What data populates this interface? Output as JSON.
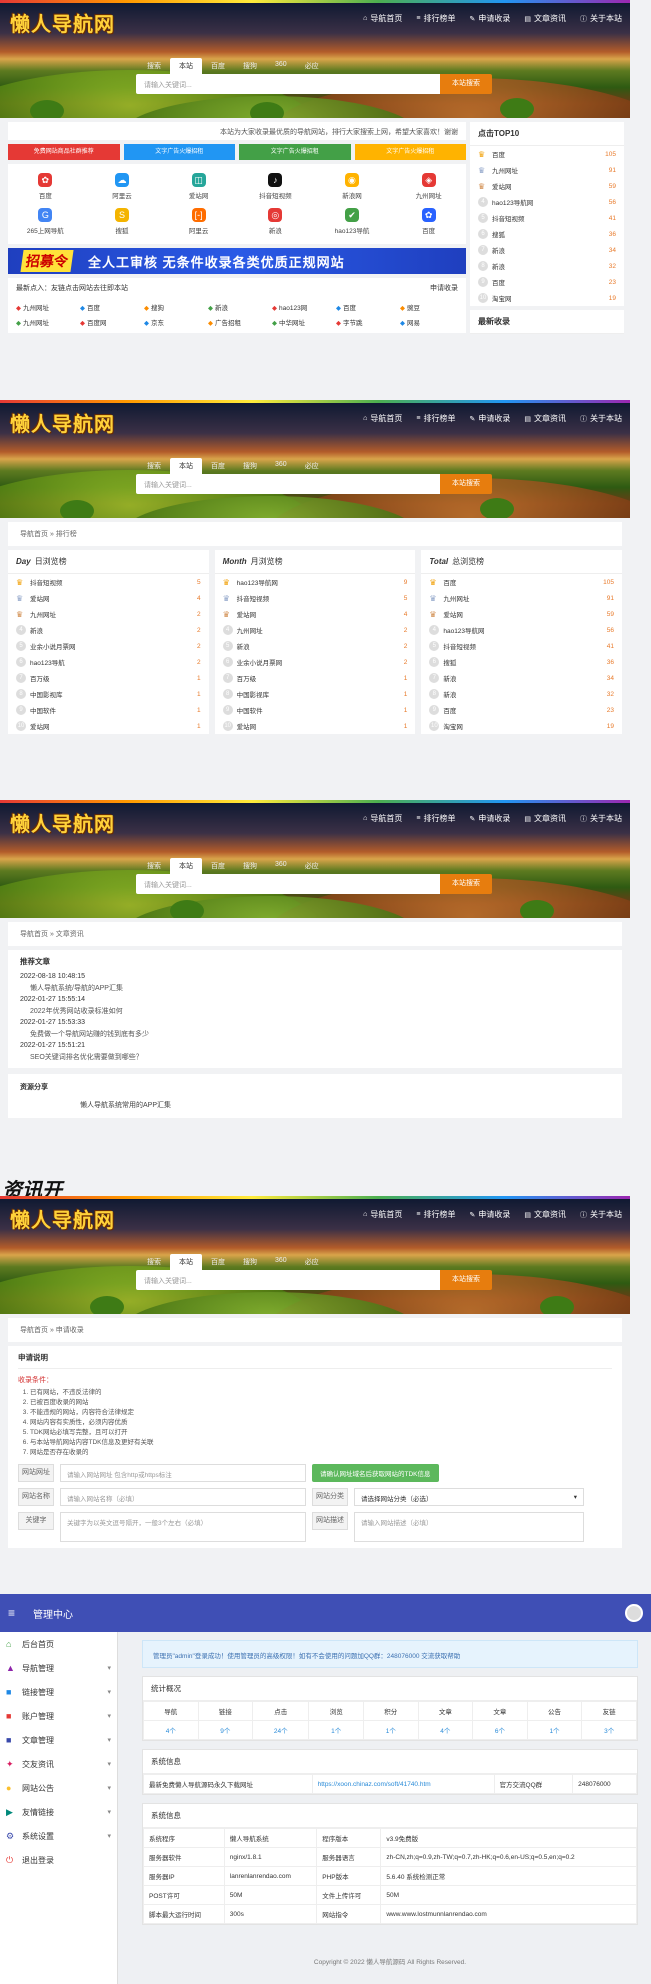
{
  "site": {
    "logo": "懒人导航网",
    "nav": [
      {
        "icon": "⌂",
        "label": "导航首页"
      },
      {
        "icon": "≡",
        "label": "排行榜单"
      },
      {
        "icon": "✎",
        "label": "申请收录"
      },
      {
        "icon": "▤",
        "label": "文章资讯"
      },
      {
        "icon": "ⓘ",
        "label": "关于本站"
      }
    ],
    "search_tabs": [
      "搜索",
      "本站",
      "百度",
      "搜狗",
      "360",
      "必应"
    ],
    "search_placeholder": "请输入关键词...",
    "search_button": "本站搜索"
  },
  "home": {
    "notice": "本站为大家收录最优质的导航网站，排行大家搜索上网，希望大家喜欢！谢谢",
    "ads": [
      {
        "label": "免费网站商品社群推荐",
        "color": "#e53935"
      },
      {
        "label": "文字广告火爆招租",
        "color": "#2196f3"
      },
      {
        "label": "文字广告火爆招租",
        "color": "#43a047"
      },
      {
        "label": "文字广告火爆招租",
        "color": "#ffb300"
      }
    ],
    "icons": [
      {
        "label": "百度",
        "glyph": "✿",
        "color": "#e53935"
      },
      {
        "label": "阿里云",
        "glyph": "☁",
        "color": "#2196f3"
      },
      {
        "label": "爱站网",
        "glyph": "◫",
        "color": "#26a69a"
      },
      {
        "label": "抖音短视频",
        "glyph": "♪",
        "color": "#111111"
      },
      {
        "label": "新浪网",
        "glyph": "◉",
        "color": "#ffb300"
      },
      {
        "label": "九州网址",
        "glyph": "◈",
        "color": "#e53935"
      },
      {
        "label": "265上网导航",
        "glyph": "G",
        "color": "#4285f4"
      },
      {
        "label": "搜狐",
        "glyph": "S",
        "color": "#f4b400"
      },
      {
        "label": "阿里云",
        "glyph": "[-]",
        "color": "#ff6d00"
      },
      {
        "label": "新浪",
        "glyph": "◎",
        "color": "#e53935"
      },
      {
        "label": "hao123导航",
        "glyph": "✔",
        "color": "#43a047"
      },
      {
        "label": "百度",
        "glyph": "✿",
        "color": "#2962ff"
      }
    ],
    "banner_tag": "招募令",
    "banner_text": "全人工审核 无条件收录各类优质正规网站",
    "include_label": "最新点入：友链点击网站去往即本站",
    "include_btn": "申请收录",
    "sites": [
      "九州网址",
      "百度",
      "搜狗",
      "新浪",
      "hao123网",
      "百度",
      "豌豆",
      "九州网址",
      "百度网",
      "京东",
      "广告招租",
      "中华网址",
      "字节跳",
      "网易"
    ],
    "top_title": "点击TOP10",
    "top": [
      {
        "name": "百度",
        "count": "105"
      },
      {
        "name": "九州网址",
        "count": "91"
      },
      {
        "name": "爱站网",
        "count": "59"
      },
      {
        "name": "hao123导航网",
        "count": "56"
      },
      {
        "name": "抖音短视频",
        "count": "41"
      },
      {
        "name": "搜狐",
        "count": "36"
      },
      {
        "name": "新浪",
        "count": "34"
      },
      {
        "name": "新浪",
        "count": "32"
      },
      {
        "name": "百度",
        "count": "23"
      },
      {
        "name": "淘宝网",
        "count": "19"
      }
    ],
    "side2_title": "最新收录"
  },
  "ranking": {
    "crumb": "导航首页 » 排行榜",
    "cols": [
      {
        "tag": "Day",
        "title": "日浏览榜",
        "rows": [
          {
            "name": "抖音短视频",
            "count": "5"
          },
          {
            "name": "爱站网",
            "count": "4"
          },
          {
            "name": "九州网址",
            "count": "2"
          },
          {
            "name": "新浪",
            "count": "2"
          },
          {
            "name": "业余小说月票网",
            "count": "2"
          },
          {
            "name": "hao123导航",
            "count": "2"
          },
          {
            "name": "百万级",
            "count": "1"
          },
          {
            "name": "中国影视库",
            "count": "1"
          },
          {
            "name": "中国软件",
            "count": "1"
          },
          {
            "name": "爱站网",
            "count": "1"
          }
        ]
      },
      {
        "tag": "Month",
        "title": "月浏览榜",
        "rows": [
          {
            "name": "hao123导航网",
            "count": "9"
          },
          {
            "name": "抖音短视频",
            "count": "5"
          },
          {
            "name": "爱站网",
            "count": "4"
          },
          {
            "name": "九州网址",
            "count": "2"
          },
          {
            "name": "新浪",
            "count": "2"
          },
          {
            "name": "业余小说月票网",
            "count": "2"
          },
          {
            "name": "百万级",
            "count": "1"
          },
          {
            "name": "中国影视库",
            "count": "1"
          },
          {
            "name": "中国软件",
            "count": "1"
          },
          {
            "name": "爱站网",
            "count": "1"
          }
        ]
      },
      {
        "tag": "Total",
        "title": "总浏览榜",
        "rows": [
          {
            "name": "百度",
            "count": "105"
          },
          {
            "name": "九州网址",
            "count": "91"
          },
          {
            "name": "爱站网",
            "count": "59"
          },
          {
            "name": "hao123导航网",
            "count": "56"
          },
          {
            "name": "抖音短视频",
            "count": "41"
          },
          {
            "name": "搜狐",
            "count": "36"
          },
          {
            "name": "新浪",
            "count": "34"
          },
          {
            "name": "新浪",
            "count": "32"
          },
          {
            "name": "百度",
            "count": "23"
          },
          {
            "name": "淘宝网",
            "count": "19"
          }
        ]
      }
    ]
  },
  "articles": {
    "crumb": "导航首页 » 文章资讯",
    "heading": "推荐文章",
    "items": [
      {
        "date": "2022-08-18 10:48:15",
        "title": "懒人导航系统/导航的APP汇集"
      },
      {
        "date": "2022-01-27 15:55:14",
        "title": "2022年优秀网站收录标准如何"
      },
      {
        "date": "2022-01-27 15:53:33",
        "title": "免费做一个导航网站赚的钱到底有多少"
      },
      {
        "date": "2022-01-27 15:51:21",
        "title": "SEO关键词排名优化需要做到哪些？"
      }
    ],
    "share_title": "资源分享",
    "share_text": "懒人导航系统常用的APP汇集",
    "ghost_text": "资讯开"
  },
  "apply": {
    "crumb": "导航首页 » 申请收录",
    "heading": "申请说明",
    "cond_title": "收录条件：",
    "conditions": [
      "已有网站，不违反法律的",
      "已被百度收录的网站",
      "不能违规的网站，内容符合法律规定",
      "网站内容有实质性，必须内容优质",
      "TDK网站必填写完整，且可以打开",
      "与本站导航网站内容TDK信息及更好有关联",
      "网站是否存在收录的"
    ],
    "url_label": "网站网址",
    "url_ph": "请输入网站网址 包含http或https标注",
    "name_label": "网站名称",
    "name_ph": "请输入网站名称（必填）",
    "check_btn": "请确认网址域名后获取网站的TDK信息",
    "cat_label": "网站分类",
    "cat_value": "请选择网站分类（必选）",
    "kw_label": "关键字",
    "kw_ph": "关键字为以英文逗号隔开，一般3个左右（必填）",
    "desc_label": "网站描述",
    "desc_ph": "请输入网站描述（必填）"
  },
  "admin": {
    "title": "管理中心",
    "menu": [
      {
        "icon": "⌂",
        "label": "后台首页",
        "color": "#43a047",
        "arrow": ""
      },
      {
        "icon": "▲",
        "label": "导航管理",
        "color": "#8e24aa",
        "arrow": "▾"
      },
      {
        "icon": "■",
        "label": "链接管理",
        "color": "#1e88e5",
        "arrow": "▾"
      },
      {
        "icon": "■",
        "label": "账户管理",
        "color": "#e53935",
        "arrow": "▾"
      },
      {
        "icon": "■",
        "label": "文章管理",
        "color": "#3949ab",
        "arrow": "▾"
      },
      {
        "icon": "✦",
        "label": "交友资讯",
        "color": "#d81b60",
        "arrow": "▾"
      },
      {
        "icon": "●",
        "label": "网站公告",
        "color": "#fbc02d",
        "arrow": "▾"
      },
      {
        "icon": "▶",
        "label": "友情链接",
        "color": "#00897b",
        "arrow": "▾"
      },
      {
        "icon": "⚙",
        "label": "系统设置",
        "color": "#3949ab",
        "arrow": "▾"
      },
      {
        "icon": "⏻",
        "label": "退出登录",
        "color": "#e53935",
        "arrow": ""
      }
    ],
    "welcome": "管理员\"admin\"登录成功！使用管理员的高级权限！如有不会使用的问题加QQ群：248076000 交流获取帮助",
    "stat_title": "统计概况",
    "stat_head": [
      "导航",
      "链接",
      "点击",
      "浏览",
      "积分",
      "文章",
      "文章",
      "公告",
      "友链"
    ],
    "stat_vals": [
      "4个",
      "9个",
      "24个",
      "1个",
      "1个",
      "4个",
      "6个",
      "1个",
      "3个"
    ],
    "sys_title": "系统信息",
    "sys_row": [
      "最新免费懒人导航源码永久下载网址",
      "https://xoon.chinaz.com/soft/41740.htm",
      "官方交流QQ群",
      "248076000"
    ],
    "env_title": "系统信息",
    "env": [
      [
        "系统程序",
        "懒人导航系统",
        "程序版本",
        "v3.9免费版"
      ],
      [
        "服务器软件",
        "nginx/1.8.1",
        "服务器语言",
        "zh-CN,zh;q=0.9,zh-TW;q=0.7,zh-HK;q=0.6,en-US;q=0.5,en;q=0.2"
      ],
      [
        "服务器IP",
        "lanrenlanrendao.com",
        "PHP版本",
        "5.6.40 系统检测正常"
      ],
      [
        "POST许可",
        "50M",
        "文件上传许可",
        "50M"
      ],
      [
        "脚本最大运行时间",
        "300s",
        "网站指令",
        "www.www.lostmunnlanrendao.com"
      ]
    ],
    "footer": "Copyright © 2022 懒人导航源码 All Rights Reserved."
  }
}
